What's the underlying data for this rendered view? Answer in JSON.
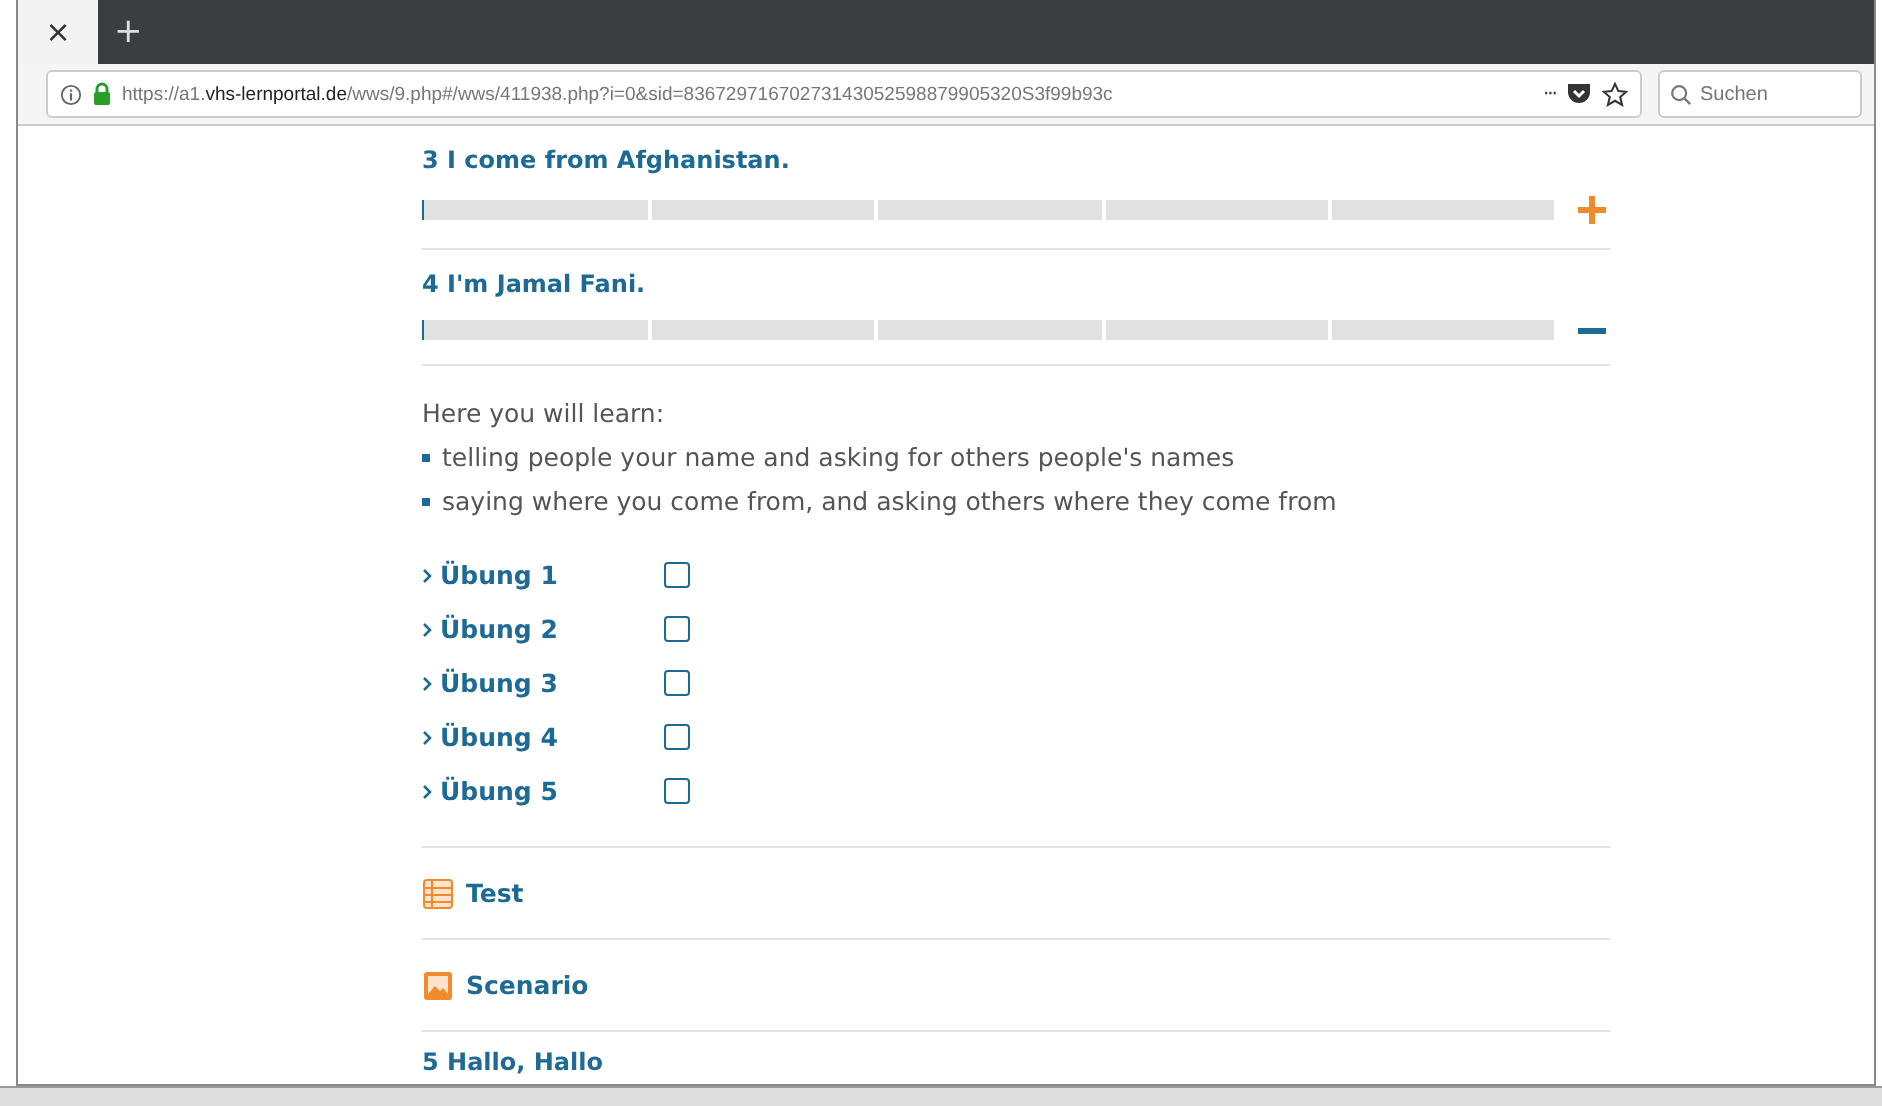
{
  "browser": {
    "tab_close": "×",
    "new_tab": "+",
    "url_host_prefix": "https://a1.",
    "url_host": "vhs-lernportal.de",
    "url_path": "/wws/9.php#/wws/411938.php?i=0&sid=83672971670273143052598879905320S3f99b93c",
    "more": "···",
    "search_placeholder": "Suchen"
  },
  "lessons": [
    {
      "title": "3 I come from Afghanistan.",
      "expanded": false,
      "level": 0
    },
    {
      "title": "4 I'm Jamal Fani.",
      "expanded": true,
      "level": 0,
      "intro": "Here you will learn:",
      "goals": [
        "telling people your name and asking for others people's names",
        "saying where you come from, and asking others where they come from"
      ],
      "exercises": [
        {
          "label": "Übung 1",
          "checked": false
        },
        {
          "label": "Übung 2",
          "checked": false
        },
        {
          "label": "Übung 3",
          "checked": false
        },
        {
          "label": "Übung 4",
          "checked": false
        },
        {
          "label": "Übung 5",
          "checked": false
        }
      ],
      "extras": [
        {
          "kind": "test",
          "label": "Test"
        },
        {
          "kind": "scenario",
          "label": "Scenario"
        }
      ]
    },
    {
      "title": "5 Hallo, Hallo"
    }
  ]
}
